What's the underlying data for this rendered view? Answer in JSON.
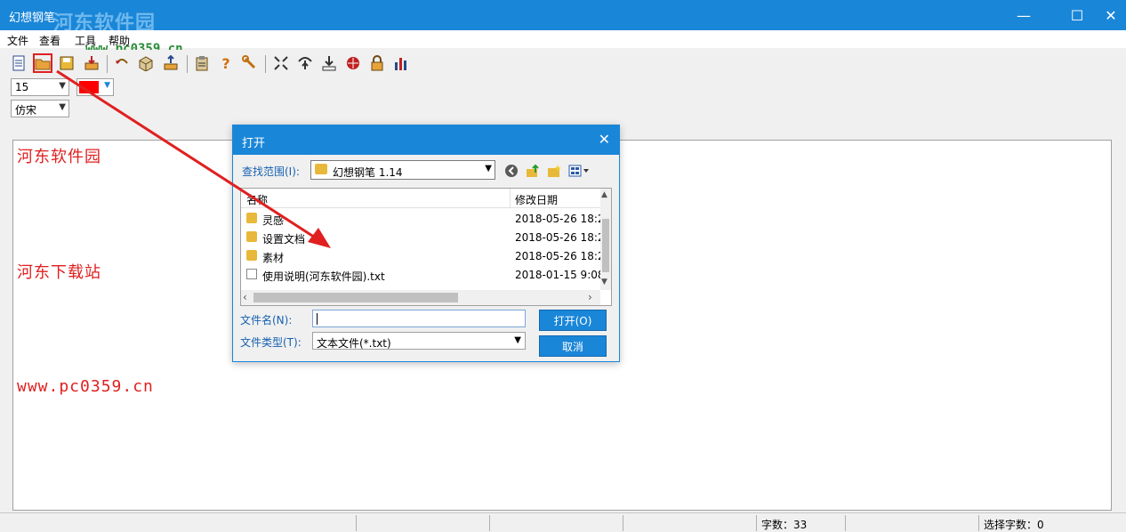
{
  "window": {
    "title": "幻想钢笔",
    "watermark": "河东软件园",
    "watermark_url": "www.pc0359.cn"
  },
  "window_controls": {
    "minimize": "—",
    "maximize": "☐",
    "close": "✕"
  },
  "menu": [
    "文件",
    "查看",
    "工具",
    "帮助"
  ],
  "format": {
    "font_size": "15",
    "font_name": "仿宋",
    "color": "#ff0000"
  },
  "editor": {
    "lines": [
      "河东软件园",
      "河东下载站",
      "www.pc0359.cn"
    ]
  },
  "status": {
    "char_count": "字数：33",
    "selected_count": "选择字数：0"
  },
  "dialog": {
    "title": "打开",
    "close": "✕",
    "look_in_label": "查找范围(I):",
    "look_in_value": "幻想钢笔 1.14",
    "columns": [
      "名称",
      "修改日期"
    ],
    "rows": [
      {
        "name": "灵感",
        "date": "2018-05-26 18:2",
        "type": "folder"
      },
      {
        "name": "设置文档",
        "date": "2018-05-26 18:2",
        "type": "folder"
      },
      {
        "name": "素材",
        "date": "2018-05-26 18:2",
        "type": "folder"
      },
      {
        "name": "使用说明(河东软件园).txt",
        "date": "2018-01-15 9:08",
        "type": "file"
      }
    ],
    "filename_label": "文件名(N):",
    "filename_value": "",
    "filetype_label": "文件类型(T):",
    "filetype_value": "文本文件(*.txt)",
    "open_button": "打开(O)",
    "cancel_button": "取消"
  },
  "colors": {
    "titlebar": "#1a86d8",
    "editor_text": "#e02020",
    "dialog_label": "#1560b0",
    "annotation": "#e02020"
  }
}
